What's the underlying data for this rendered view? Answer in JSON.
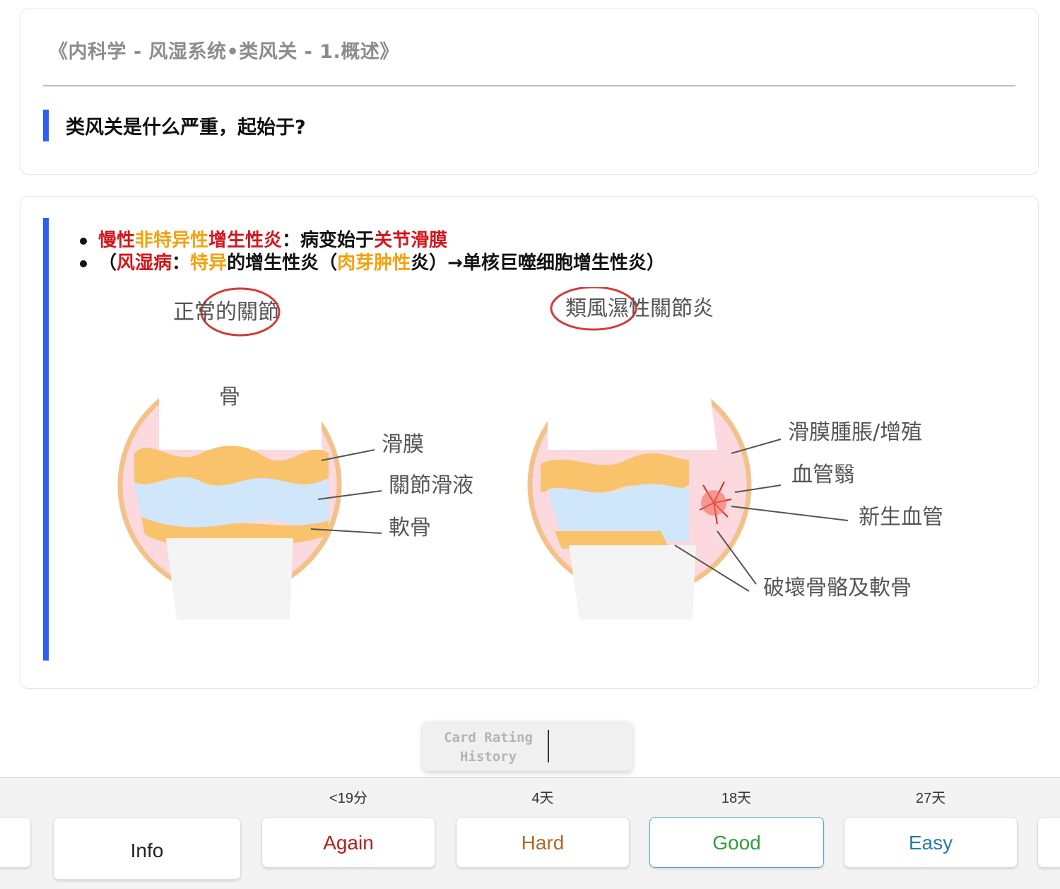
{
  "front": {
    "deck_title": "《内科学 - 风湿系统•类风关 - 1.概述》",
    "question": "类风关是什么严重，起始于?"
  },
  "back": {
    "line1": [
      {
        "text": "慢性",
        "color": "red"
      },
      {
        "text": "非特异性",
        "color": "orange"
      },
      {
        "text": "增生性炎",
        "color": "red"
      },
      {
        "text": "：病变始于",
        "color": "black"
      },
      {
        "text": "关节滑膜",
        "color": "red"
      }
    ],
    "line2": [
      {
        "text": "（",
        "color": "black"
      },
      {
        "text": "风湿病",
        "color": "red"
      },
      {
        "text": "：",
        "color": "black"
      },
      {
        "text": "特异",
        "color": "orange"
      },
      {
        "text": "的增生性炎（",
        "color": "black"
      },
      {
        "text": "肉芽肿性",
        "color": "orange"
      },
      {
        "text": "炎）→单核巨噬细胞增生性炎）",
        "color": "black"
      }
    ],
    "diagram": {
      "left_title": "正常的關節",
      "right_title": "類風濕性關節炎",
      "left_labels": {
        "bone": "骨",
        "synovium": "滑膜",
        "fluid": "關節滑液",
        "cartilage": "軟骨"
      },
      "right_labels": {
        "swelling": "滑膜腫脹/增殖",
        "pannus": "血管翳",
        "vessels": "新生血管",
        "destruction": "破壞骨骼及軟骨"
      }
    }
  },
  "history": {
    "label_line1": "Card Rating",
    "label_line2": "History"
  },
  "answer_bar": {
    "info_label": "Info",
    "buttons": [
      {
        "label": "Again",
        "timing": "<19分"
      },
      {
        "label": "Hard",
        "timing": "4天"
      },
      {
        "label": "Good",
        "timing": "18天"
      },
      {
        "label": "Easy",
        "timing": "27天"
      }
    ]
  },
  "colors": {
    "accent_bar": "#2f5ff0",
    "red": "#d4161c",
    "orange": "#f2a20f"
  }
}
